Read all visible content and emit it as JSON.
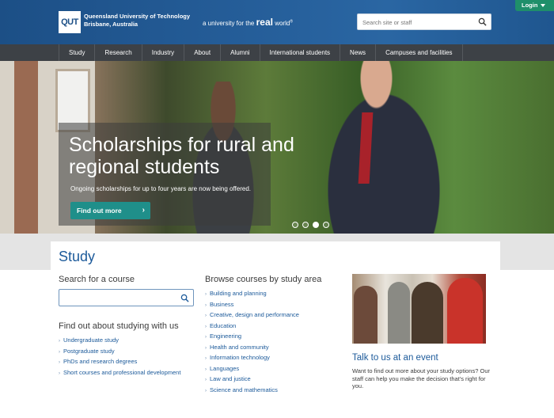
{
  "header": {
    "logo": "QUT",
    "org_name": "Queensland University of Technology",
    "org_location": "Brisbane, Australia",
    "tagline_prefix": "a university for the",
    "tagline_real": "real",
    "tagline_suffix": "world",
    "tagline_mark": "®",
    "search_placeholder": "Search site or staff",
    "login": "Login"
  },
  "nav": {
    "items": [
      "Study",
      "Research",
      "Industry",
      "About",
      "Alumni",
      "International students",
      "News",
      "Campuses and facilities"
    ]
  },
  "hero": {
    "title": "Scholarships for rural and regional students",
    "subtitle": "Ongoing scholarships for up to four years are now being offered.",
    "cta": "Find out more",
    "slides": 4,
    "active_slide": 3
  },
  "study": {
    "title": "Study",
    "search_heading": "Search for a course",
    "find_heading": "Find out about studying with us",
    "find_links": [
      "Undergraduate study",
      "Postgraduate study",
      "PhDs and research degrees",
      "Short courses and professional development"
    ],
    "browse_heading": "Browse courses by study area",
    "browse_links": [
      "Building and planning",
      "Business",
      "Creative, design and performance",
      "Education",
      "Engineering",
      "Health and community",
      "Information technology",
      "Languages",
      "Law and justice",
      "Science and mathematics"
    ],
    "event_title": "Talk to us at an event",
    "event_text": "Want to find out more about your study options? Our staff can help you make the decision that's right for you."
  },
  "colors": {
    "header_blue": "#1c4f86",
    "nav_dark": "#3d4146",
    "login_green": "#1f8f6a",
    "cta_teal": "#1f8f8a",
    "link_blue": "#1c5a9a"
  }
}
